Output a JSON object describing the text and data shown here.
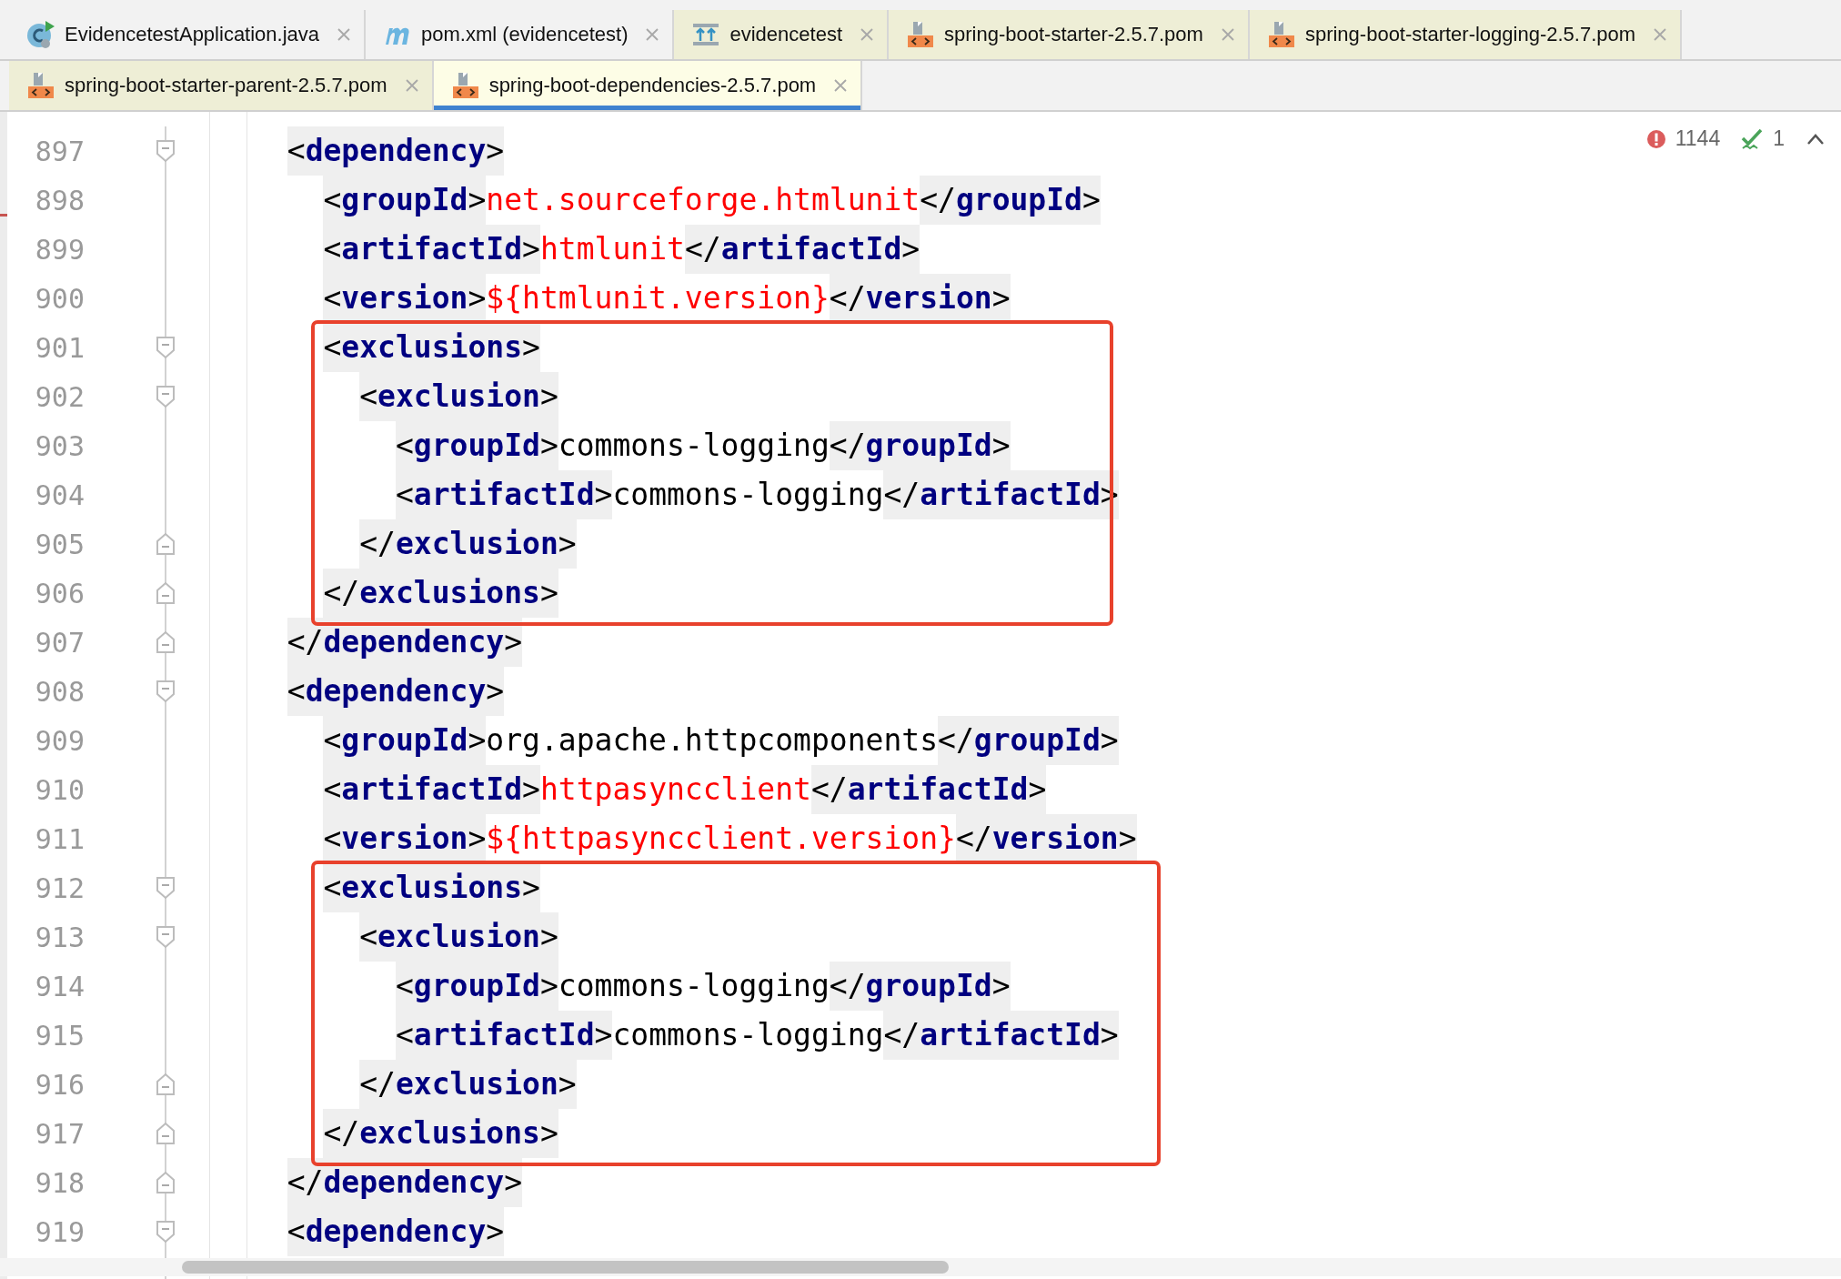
{
  "tabs_row_1": [
    {
      "label": "EvidencetestApplication.java",
      "kind": "java",
      "selected": false
    },
    {
      "label": "pom.xml (evidencetest)",
      "kind": "maven",
      "selected": false
    },
    {
      "label": "evidencetest",
      "kind": "module",
      "selected": false
    },
    {
      "label": "spring-boot-starter-2.5.7.pom",
      "kind": "pom",
      "selected": false
    },
    {
      "label": "spring-boot-starter-logging-2.5.7.pom",
      "kind": "pom",
      "selected": false
    }
  ],
  "tabs_row_2": [
    {
      "label": "spring-boot-starter-parent-2.5.7.pom",
      "kind": "pom",
      "selected": false
    },
    {
      "label": "spring-boot-dependencies-2.5.7.pom",
      "kind": "pom",
      "selected": true
    }
  ],
  "inspections": {
    "errors": "1144",
    "warnings": "1"
  },
  "editor": {
    "blocks": [
      {
        "kind": "line",
        "number": "897",
        "fold_open": true,
        "fold_close": false,
        "code": "  <dependency>"
      },
      {
        "kind": "line",
        "number": "898",
        "fold_open": false,
        "fold_close": false,
        "code": "    <groupId>net.sourceforge.htmlunit</groupId>",
        "unresolved": true
      },
      {
        "kind": "line",
        "number": "899",
        "fold_open": false,
        "fold_close": false,
        "code": "    <artifactId>htmlunit</artifactId>",
        "unresolved": true
      },
      {
        "kind": "line",
        "number": "900",
        "fold_open": false,
        "fold_close": false,
        "code": "    <version>${htmlunit.version}</version>",
        "unresolved": true
      },
      {
        "kind": "frame",
        "lines": [
          {
            "number": "901",
            "fold_open": true,
            "fold_close": false,
            "code": "    <exclusions>"
          },
          {
            "number": "902",
            "fold_open": true,
            "fold_close": false,
            "code": "      <exclusion>"
          },
          {
            "number": "903",
            "fold_open": false,
            "fold_close": false,
            "code": "        <groupId>commons-logging</groupId>",
            "unresolved": false
          },
          {
            "number": "904",
            "fold_open": false,
            "fold_close": false,
            "code": "        <artifactId>commons-logging</artifactId>",
            "unresolved": false
          },
          {
            "number": "905",
            "fold_open": false,
            "fold_close": true,
            "code": "      </exclusion>"
          },
          {
            "number": "906",
            "fold_open": false,
            "fold_close": true,
            "code": "    </exclusions>"
          }
        ]
      },
      {
        "kind": "line",
        "number": "907",
        "fold_open": false,
        "fold_close": true,
        "code": "  </dependency>"
      },
      {
        "kind": "line",
        "number": "908",
        "fold_open": true,
        "fold_close": false,
        "code": "  <dependency>"
      },
      {
        "kind": "line",
        "number": "909",
        "fold_open": false,
        "fold_close": false,
        "code": "    <groupId>org.apache.httpcomponents</groupId>",
        "unresolved": false
      },
      {
        "kind": "line",
        "number": "910",
        "fold_open": false,
        "fold_close": false,
        "code": "    <artifactId>httpasyncclient</artifactId>",
        "unresolved": true
      },
      {
        "kind": "line",
        "number": "911",
        "fold_open": false,
        "fold_close": false,
        "code": "    <version>${httpasyncclient.version}</version>",
        "unresolved": true
      },
      {
        "kind": "frame",
        "lines": [
          {
            "number": "912",
            "fold_open": true,
            "fold_close": false,
            "code": "    <exclusions>"
          },
          {
            "number": "913",
            "fold_open": true,
            "fold_close": false,
            "code": "      <exclusion>"
          },
          {
            "number": "914",
            "fold_open": false,
            "fold_close": false,
            "code": "        <groupId>commons-logging</groupId>",
            "unresolved": false
          },
          {
            "number": "915",
            "fold_open": false,
            "fold_close": false,
            "code": "        <artifactId>commons-logging</artifactId>",
            "unresolved": false
          },
          {
            "number": "916",
            "fold_open": false,
            "fold_close": true,
            "code": "      </exclusion>"
          },
          {
            "number": "917",
            "fold_open": false,
            "fold_close": true,
            "code": "    </exclusions>"
          }
        ]
      },
      {
        "kind": "line",
        "number": "918",
        "fold_open": false,
        "fold_close": true,
        "code": "  </dependency>"
      },
      {
        "kind": "line",
        "number": "919",
        "fold_open": true,
        "fold_close": false,
        "code": "  <dependency>"
      }
    ]
  }
}
